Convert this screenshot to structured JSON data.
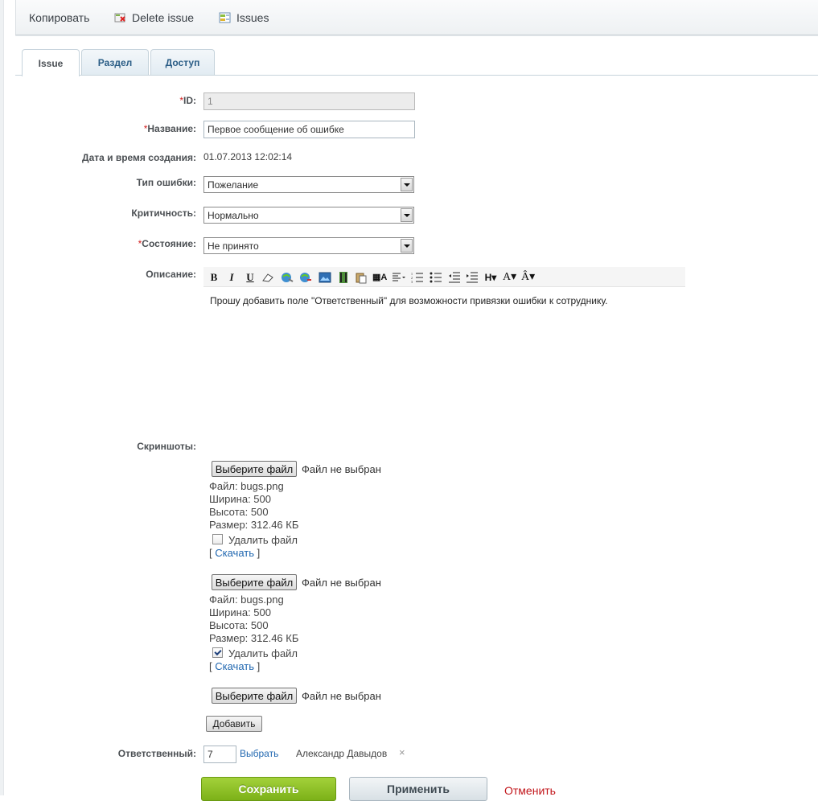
{
  "toolbar": {
    "copy_label": "Копировать",
    "delete_label": "Delete issue",
    "issues_label": "Issues"
  },
  "tabs": [
    {
      "label": "Issue",
      "active": true
    },
    {
      "label": "Раздел",
      "active": false
    },
    {
      "label": "Доступ",
      "active": false
    }
  ],
  "form": {
    "id": {
      "label": "ID:",
      "required": "*",
      "value": "1"
    },
    "name": {
      "label": "Название:",
      "required": "*",
      "value": "Первое сообщение об ошибке"
    },
    "created": {
      "label": "Дата и время создания:",
      "value": "01.07.2013 12:02:14"
    },
    "type": {
      "label": "Тип ошибки:",
      "value": "Пожелание"
    },
    "severity": {
      "label": "Критичность:",
      "value": "Нормально"
    },
    "status": {
      "label": "Состояние:",
      "required": "*",
      "value": "Не принято"
    },
    "description": {
      "label": "Описание:",
      "text": "Прошу добавить поле \"Ответственный\" для возможности привязки ошибки к сотруднику."
    },
    "screenshots": {
      "label": "Скриншоты:",
      "choose_label": "Выберите файл",
      "no_file_label": "Файл не выбран",
      "files": [
        {
          "file": "Файл: bugs.png",
          "width": "Ширина: 500",
          "height": "Высота: 500",
          "size": "Размер: 312.46 КБ",
          "delete_label": "Удалить файл",
          "delete_checked": false,
          "download_open": "[",
          "download_label": "Скачать",
          "download_close": "]"
        },
        {
          "file": "Файл: bugs.png",
          "width": "Ширина: 500",
          "height": "Высота: 500",
          "size": "Размер: 312.46 КБ",
          "delete_label": "Удалить файл",
          "delete_checked": true,
          "download_open": "[",
          "download_label": "Скачать",
          "download_close": "]"
        }
      ],
      "add_label": "Добавить"
    },
    "responsible": {
      "label": "Ответственный:",
      "value": "7",
      "choose_label": "Выбрать",
      "name": "Александр Давыдов",
      "remove_glyph": "×"
    }
  },
  "actions": {
    "save_label": "Сохранить",
    "apply_label": "Применить",
    "cancel_label": "Отменить"
  },
  "colors": {
    "accent_link": "#2067b0",
    "required": "#d21f1f",
    "save_button": "#8cbd1e",
    "cancel_link": "#c2161b"
  }
}
